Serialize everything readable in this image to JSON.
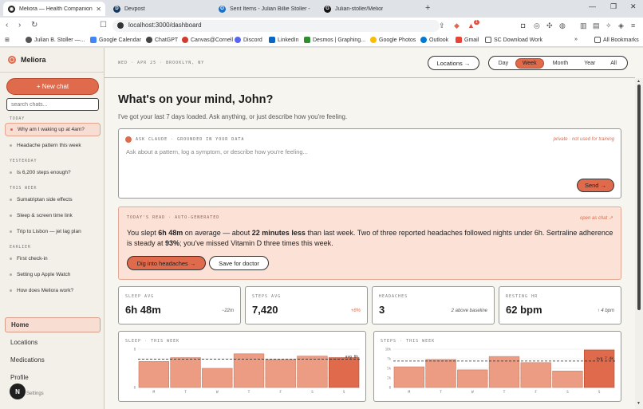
{
  "browser": {
    "tabs": [
      {
        "title": "Meliora — Health Companion",
        "active": true
      },
      {
        "title": "Devpost"
      },
      {
        "title": "Sent Items - Julian Billie Stoller - Outl"
      },
      {
        "title": "Julian-stoller/Melior"
      }
    ],
    "url": "localhost:3000/dashboard",
    "bookmarks": [
      "Julian B. Stoller —...",
      "Google Calendar",
      "ChatGPT",
      "Canvas@Cornell",
      "Discord",
      "LinkedIn",
      "Desmos | Graphing...",
      "Google Photos",
      "Outlook",
      "Gmail",
      "SC Download Work",
      "All Bookmarks"
    ],
    "notification_count": "1"
  },
  "sidebar": {
    "brand": "Meliora",
    "new_chat": "+ New chat",
    "search_placeholder": "search chats...",
    "groups": [
      {
        "label": "TODAY",
        "items": [
          "Why am I waking up at 4am?",
          "Headache pattern this week"
        ]
      },
      {
        "label": "YESTERDAY",
        "items": [
          "Is 6,200 steps enough?"
        ]
      },
      {
        "label": "THIS WEEK",
        "items": [
          "Sumatriptan side effects",
          "Sleep & screen time link",
          "Trip to Lisbon — jet lag plan"
        ]
      },
      {
        "label": "EARLIER",
        "items": [
          "First check-in",
          "Setting up Apple Watch",
          "How does Meliora work?"
        ]
      }
    ],
    "nav": [
      "Home",
      "Locations",
      "Medications",
      "Profile"
    ],
    "avatar_initial": "N",
    "settings": "Settings"
  },
  "topbar": {
    "dateline": "WED · APR 25 · BROOKLYN, NY",
    "locations_button": "Locations →",
    "ranges": [
      "Day",
      "Week",
      "Month",
      "Year",
      "All"
    ],
    "selected_range": "Week"
  },
  "main": {
    "greeting": "What's on your mind, John?",
    "subtitle": "I've got your last 7 days loaded. Ask anything, or just describe how you're feeling.",
    "ask": {
      "header": "ASK CLAUDE · GROUNDED IN YOUR DATA",
      "privacy": "private · not used for training",
      "placeholder": "Ask about a pattern, log a symptom, or describe how you're feeling...",
      "send": "Send →"
    },
    "read": {
      "header": "TODAY'S READ · AUTO-GENERATED",
      "open": "open as chat ↗",
      "p1": "You slept ",
      "b1": "6h 48m",
      "p2": " on average — about ",
      "b2": "22 minutes less",
      "p3": " than last week. Two of three reported headaches followed nights under 6h. Sertraline adherence is steady at ",
      "b3": "93%",
      "p4": "; you've missed Vitamin D three times this week.",
      "dig_button": "Dig into headaches →",
      "save_button": "Save for doctor"
    },
    "stats": [
      {
        "label": "SLEEP AVG",
        "value": "6h 48m",
        "delta": "−22m"
      },
      {
        "label": "STEPS AVG",
        "value": "7,420",
        "delta": "+8%"
      },
      {
        "label": "HEADACHES",
        "value": "3",
        "delta": "2 above baseline"
      },
      {
        "label": "RESTING HR",
        "value": "62 bpm",
        "delta": "↑ 4 bpm"
      }
    ]
  },
  "chart_data": [
    {
      "type": "bar",
      "title": "SLEEP · THIS WEEK",
      "categories": [
        "M",
        "T",
        "W",
        "T",
        "F",
        "S",
        "S"
      ],
      "values": [
        6.8,
        7.8,
        5.0,
        8.8,
        7.3,
        8.2,
        7.8
      ],
      "ylim": [
        0,
        10
      ],
      "yticks": [
        "0",
        "",
        "",
        "",
        "8"
      ],
      "avg_label": "avg 6h",
      "avg_value": 7.4,
      "highlight_index": 6
    },
    {
      "type": "bar",
      "title": "STEPS · THIS WEEK",
      "categories": [
        "M",
        "T",
        "W",
        "T",
        "F",
        "S",
        "S"
      ],
      "values": [
        5400,
        7300,
        4600,
        8100,
        6500,
        4300,
        9800
      ],
      "ylim": [
        0,
        10000
      ],
      "yticks": [
        "0",
        "2k",
        "5k",
        "7k",
        "10k"
      ],
      "avg_label": "avg 7.4k",
      "avg_value": 6900,
      "highlight_index": 6
    }
  ],
  "colors": {
    "accent": "#e06a4c",
    "bar": "#ec9c82",
    "bar_highlight": "#e06a4c"
  }
}
